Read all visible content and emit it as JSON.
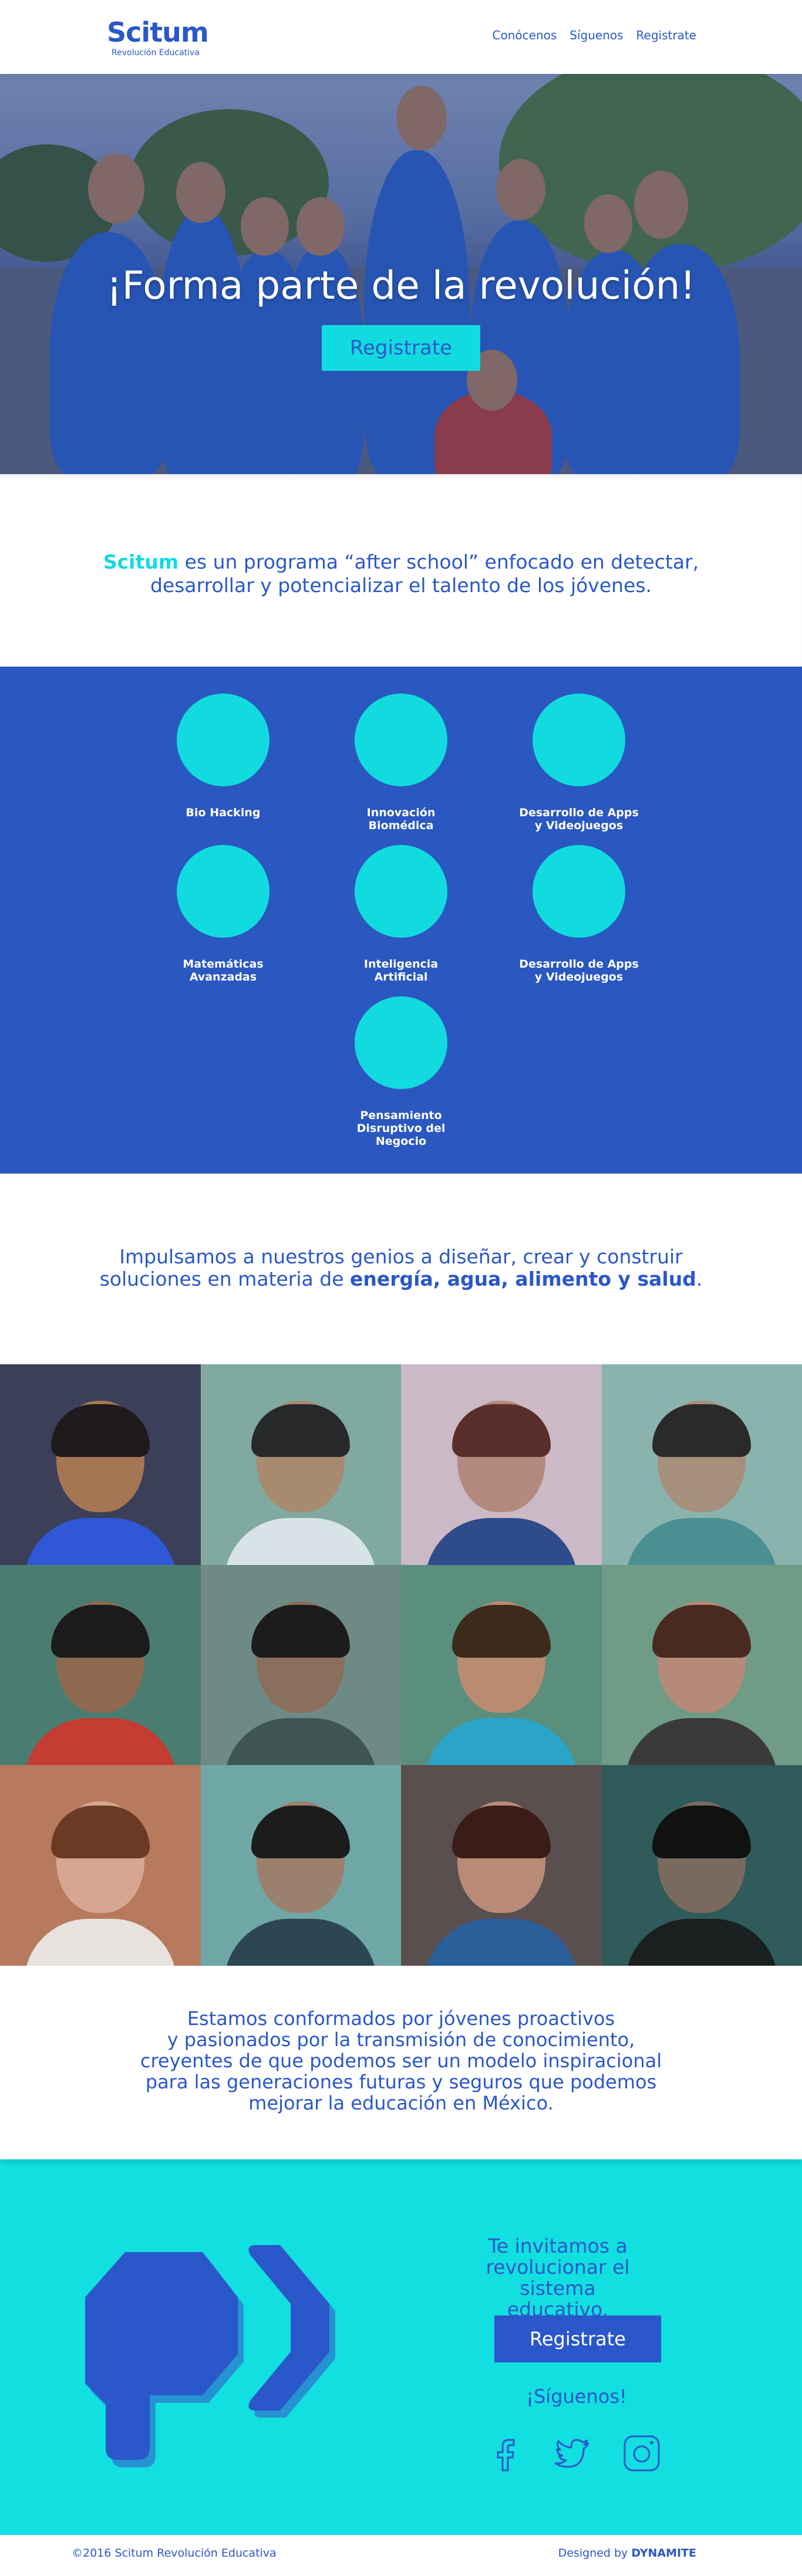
{
  "header": {
    "logo_text": "Scitum",
    "logo_subtitle": "Revolución Educativa",
    "nav": [
      "Conócenos",
      "Síguenos",
      "Registrate"
    ]
  },
  "hero": {
    "title": "¡Forma parte de la revolución!",
    "button": "Registrate"
  },
  "intro": {
    "brand": "Scitum",
    "line1_rest": " es un programa “after school” enfocado en detectar,",
    "line2": "desarrollar y potencializar el talento de los jóvenes."
  },
  "programs": {
    "items": [
      {
        "line1": "Bio Hacking",
        "line2": "",
        "line3": ""
      },
      {
        "line1": "Innovación",
        "line2": "Biomédica",
        "line3": ""
      },
      {
        "line1": "Desarrollo de Apps",
        "line2": "y Videojuegos",
        "line3": ""
      },
      {
        "line1": "Matemáticas",
        "line2": "Avanzadas",
        "line3": ""
      },
      {
        "line1": "Inteligencia",
        "line2": "Artificial",
        "line3": ""
      },
      {
        "line1": "Desarrollo de Apps",
        "line2": "y Videojuegos",
        "line3": ""
      },
      {
        "line1": "Pensamiento",
        "line2": "Disruptivo del",
        "line3": "Negocio"
      }
    ]
  },
  "genios": {
    "line1": "Impulsamos a nuestros genios a diseñar, crear y construir",
    "line2_start": "soluciones en materia de ",
    "line2_bold": "energía, agua, alimento y salud",
    "line2_end": "."
  },
  "about": {
    "lines": [
      "Estamos conformados por jóvenes proactivos",
      "y pasionados por la transmisión de conocimiento,",
      "creyentes de que podemos ser un modelo inspiracional",
      "para las generaciones futuras y seguros que podemos",
      "mejorar la educación en México."
    ]
  },
  "cta": {
    "line1": "Te invitamos a",
    "line2": "revolucionar el sistema",
    "line3": "educativo.",
    "button": "Registrate",
    "follow": "¡Síguenos!",
    "icons": [
      "facebook-icon",
      "twitter-icon",
      "instagram-icon"
    ]
  },
  "footer": {
    "copyright": "©2016 Scitum Revolución Educativa",
    "designed_by": "Designed by ",
    "designer": "DYNAMITE"
  },
  "colors": {
    "brand_blue": "#2a57c9",
    "accent_cyan": "#12dbe0",
    "program_bg": "#2a57c0"
  }
}
